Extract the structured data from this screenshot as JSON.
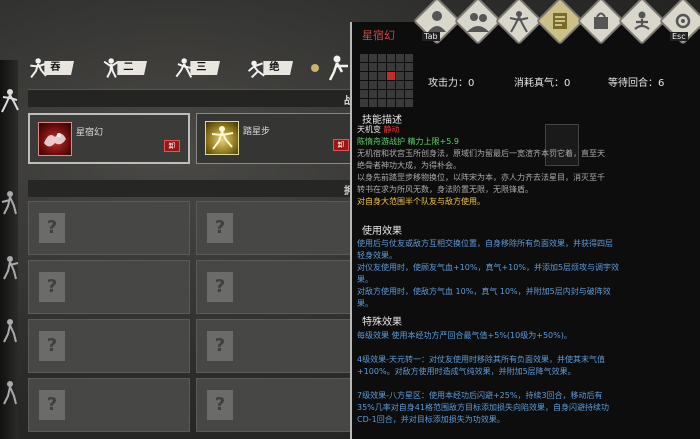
{
  "tabs": [
    {
      "label": "吞吐"
    },
    {
      "label": "二式"
    },
    {
      "label": "三式"
    },
    {
      "label": "绝式"
    }
  ],
  "equipped_header": "战",
  "learned_header": "拥",
  "equipped_skills": [
    {
      "name": "星宿幻",
      "remove_label": "卸"
    },
    {
      "name": "踏星步",
      "remove_label": "卸"
    }
  ],
  "detail": {
    "title": "星宿幻",
    "attack_label": "攻击力：0",
    "cost_label": "消耗真气：0",
    "wait_label": "等待回合：6",
    "desc_head": "技能描述",
    "desc_line1_a": "天机变",
    "desc_line1_b": "静动",
    "desc_line2": "陈惰舟游战护 精力上限+5.9",
    "desc_line3": "无机宿和状宫玉所创身法，原域们为留最后一宽渲齐本罚它着，直至天",
    "desc_line4": "绝骨者神功大成，为得朴会。",
    "desc_line5": "以身先前踏罡步移物换位，以阵宋为本，亦人力齐去法星目，消灭至千",
    "desc_line6": "转书在求为所风无数，身法阶置无限，无限锋盾。",
    "desc_line7": "对自身大范围半个队友与敌方使用。",
    "use_head": "使用效果",
    "use_lines": [
      "使用后与仗友或敌方互相交换位置，自身移除所有负面效果，并获得四层",
      "轻身效果。",
      "对仪友使用时，使顾友气血+10%，真气+10%，并添加5层烦攻与调宇效",
      "果。",
      "对敌方使用时，使敌方气血 10%，真气 10%，并附加5层内封与破阵效",
      "果。"
    ],
    "special_head": "特殊效果",
    "special_lines": [
      "每级效果 使用本经功方严回合最气值+5%(10级为+50%)。",
      "",
      "4级效果-天元转一：对仗友使用时移除其所有负面效果，并使其末气值",
      "+100%。对敌方使用时造成气纯效果，并附加5层降气效果。",
      "",
      "7级效果-八方星区：使用本经功后闪避+25%，持续3回合，移动后有",
      "35%几率对自身41格范围敌方目标添加损失向陷效果，自身闪避持续功",
      "CD-1回合，并对目标添加损失为功效果。"
    ]
  },
  "top_icons": [
    {
      "name": "icon-1",
      "key": "Tab"
    },
    {
      "name": "icon-2",
      "key": ""
    },
    {
      "name": "icon-3",
      "key": ""
    },
    {
      "name": "icon-4",
      "key": ""
    },
    {
      "name": "icon-5",
      "key": ""
    },
    {
      "name": "icon-6",
      "key": ""
    },
    {
      "name": "icon-7",
      "key": "Esc"
    }
  ],
  "empty_slot_mark": "?"
}
